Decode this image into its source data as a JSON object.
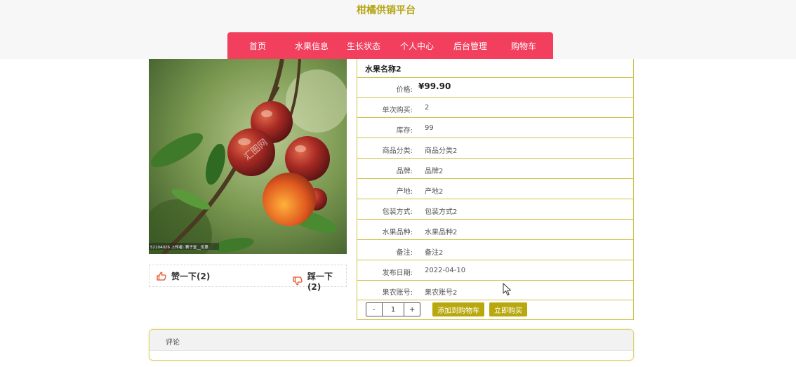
{
  "site": {
    "title": "柑橘供销平台"
  },
  "nav": {
    "items": [
      {
        "label": "首页"
      },
      {
        "label": "水果信息"
      },
      {
        "label": "生长状态"
      },
      {
        "label": "个人中心"
      },
      {
        "label": "后台管理"
      },
      {
        "label": "购物车"
      }
    ]
  },
  "product": {
    "name": "水果名称2",
    "price_label": "价格:",
    "price": "¥99.90",
    "rows": [
      {
        "label": "单次购买:",
        "value": "2"
      },
      {
        "label": "库存:",
        "value": "99"
      },
      {
        "label": "商品分类:",
        "value": "商品分类2"
      },
      {
        "label": "品牌:",
        "value": "品牌2"
      },
      {
        "label": "产地:",
        "value": "产地2"
      },
      {
        "label": "包装方式:",
        "value": "包装方式2"
      },
      {
        "label": "水果品种:",
        "value": "水果品种2"
      },
      {
        "label": "备注:",
        "value": "备注2"
      },
      {
        "label": "发布日期:",
        "value": "2022-04-10"
      },
      {
        "label": "果农账号:",
        "value": "果农账号2"
      }
    ],
    "quantity": {
      "minus": "-",
      "value": "1",
      "plus": "+"
    },
    "add_to_cart_label": "添加到购物车",
    "buy_now_label": "立即购买"
  },
  "photo": {
    "watermark_logo": "汇图网",
    "caption": "52104026 上传者: 赛子堂__优惠"
  },
  "votes": {
    "like_label": "赞一下(2)",
    "dislike_label": "踩一下(2)"
  },
  "comments": {
    "title": "评论"
  },
  "colors": {
    "nav_bg": "#f23f5e",
    "accent": "#b8a80d",
    "border": "#d2c14a",
    "title": "#b5a513"
  },
  "icons": {
    "like": "thumbs-up-icon",
    "dislike": "thumbs-down-icon",
    "cursor": "mouse-pointer-icon"
  }
}
